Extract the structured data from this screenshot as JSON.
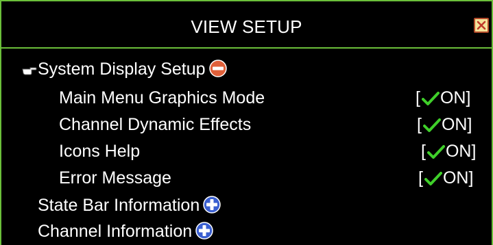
{
  "window": {
    "title": "VIEW SETUP",
    "close_icon": "close-icon"
  },
  "colors": {
    "border": "#6bbf3a",
    "background": "#000000",
    "text": "#ffffff",
    "check": "#3fcf2a",
    "minus": "#e0603a",
    "plus": "#3a5fd0"
  },
  "menu": {
    "system_display": {
      "label": "System Display Setup",
      "state_icon": "collapse-minus-icon",
      "items": [
        {
          "label": "Main Menu Graphics Mode",
          "bracket_open": "[",
          "value": "ON]"
        },
        {
          "label": "Channel Dynamic Effects",
          "bracket_open": "[",
          "value": "ON]"
        },
        {
          "label": "Icons Help",
          "bracket_open": "[",
          "value": "ON]"
        },
        {
          "label": "Error Message",
          "bracket_open": "[",
          "value": "ON]"
        }
      ]
    },
    "state_bar": {
      "label": "State Bar Information",
      "state_icon": "expand-plus-icon"
    },
    "channel_info": {
      "label": "Channel Information",
      "state_icon": "expand-plus-icon"
    }
  }
}
